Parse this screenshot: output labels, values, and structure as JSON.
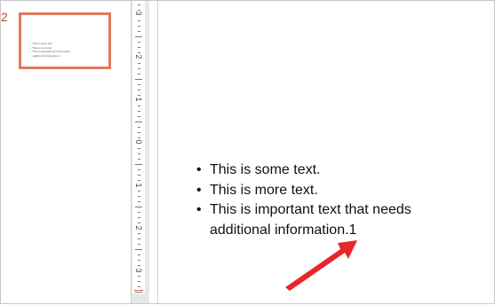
{
  "thumbnail": {
    "slide_number": "2",
    "lines": [
      "This is some text.",
      "This is more text.",
      "This is important text that needs",
      "additional information.1"
    ]
  },
  "ruler": {
    "labels": [
      "3",
      "2",
      "1",
      "0",
      "1",
      "2",
      "3"
    ]
  },
  "slide": {
    "bullets": [
      {
        "text": "This is some text."
      },
      {
        "text": "This is more text."
      },
      {
        "text": "This is important text that needs",
        "continuation": "additional information.1"
      }
    ]
  },
  "annotation": {
    "arrow_color": "#e8262b"
  }
}
